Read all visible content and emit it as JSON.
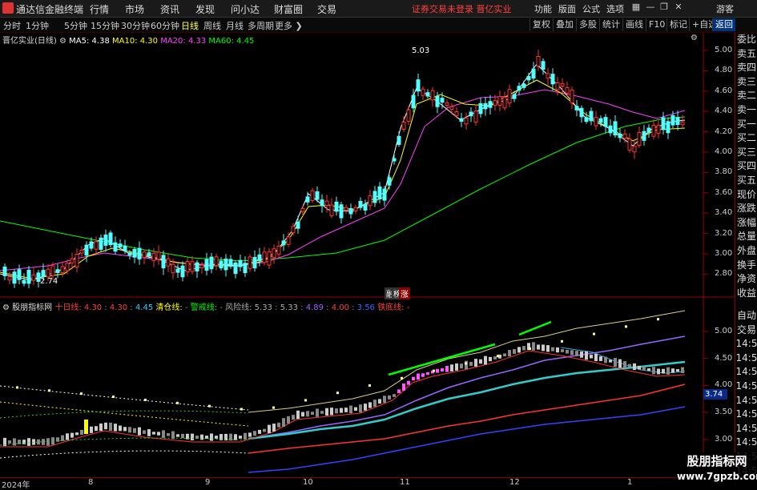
{
  "topbar": {
    "app_title": "通达信金融终端",
    "menus": [
      "行情",
      "市场",
      "资讯",
      "发现",
      "问小达",
      "财富圈",
      "交易"
    ],
    "notice": "证券交易未登录",
    "stock_name": "晋亿实业",
    "right_menus": [
      "功能",
      "版面",
      "公式",
      "选项"
    ],
    "user": "游客"
  },
  "periodbar": {
    "periods": [
      "分时",
      "1分钟",
      "5分钟",
      "15分钟",
      "30分钟",
      "60分钟",
      "日线",
      "周线",
      "月线",
      "多周期",
      "更多"
    ],
    "active_period": "日线",
    "tools": [
      "复权",
      "叠加",
      "多股",
      "统计",
      "画线",
      "F10",
      "标记",
      "+自选",
      "返回"
    ]
  },
  "kline": {
    "title": "晋亿实业(日线)",
    "ma_labels": [
      {
        "name": "MA5: 4.38",
        "color": "#ffffff"
      },
      {
        "name": "MA10: 4.30",
        "color": "#ffff00"
      },
      {
        "name": "MA20: 4.33",
        "color": "#ff40ff"
      },
      {
        "name": "MA60: 4.45",
        "color": "#00ff00"
      }
    ],
    "y_ticks": [
      "5.00",
      "4.80",
      "4.60",
      "4.40",
      "4.20",
      "4.00",
      "3.80",
      "3.60",
      "3.40",
      "3.20",
      "3.00",
      "2.80"
    ],
    "high_label": "5.03",
    "low_label": "2.74",
    "badges": [
      "融",
      "榜",
      "涨"
    ]
  },
  "indicator": {
    "name": "股朋指标网",
    "items": [
      {
        "label": "十日线:",
        "value": "4.30",
        "color": "#ff4040"
      },
      {
        "label": "",
        "value": "4.30",
        "color": "#ff4040"
      },
      {
        "label": "",
        "value": "4.45",
        "color": "#33ccff"
      },
      {
        "label": "清仓线:",
        "value": "",
        "color": "#ffff00"
      },
      {
        "label": "警戒线:",
        "value": "",
        "color": "#00ff00"
      },
      {
        "label": "风险线:",
        "value": "5.33",
        "color": "#aaaaaa"
      },
      {
        "label": "",
        "value": "5.33",
        "color": "#aaaaaa"
      },
      {
        "label": "",
        "value": "4.89",
        "color": "#9966ff"
      },
      {
        "label": "",
        "value": "4.00",
        "color": "#ff4040"
      },
      {
        "label": "",
        "value": "3.56",
        "color": "#3366ff"
      },
      {
        "label": "铁底线:",
        "value": "-",
        "color": "#ff4040"
      }
    ],
    "y_ticks": [
      "5.00",
      "4.50",
      "4.00",
      "3.50",
      "3.00"
    ],
    "current_value": "3.74"
  },
  "right_panel_top": [
    "委比",
    "卖五",
    "卖四",
    "卖三",
    "卖二",
    "卖一",
    "买一",
    "买二",
    "买三",
    "买四",
    "买五",
    "现价",
    "涨跌",
    "涨幅",
    "总量",
    "外盘",
    "换手",
    "净资",
    "收益"
  ],
  "right_panel_bottom": [
    "自动",
    "交易",
    "14:5",
    "14:5",
    "14:5",
    "14:5",
    "14:5",
    "14:5",
    "14:5",
    "14:5",
    "14:5",
    "14:5"
  ],
  "dateaxis": {
    "labels": [
      "2024年",
      "8",
      "9",
      "10",
      "11",
      "12",
      "1"
    ]
  },
  "watermark": {
    "line1": "股朋指标网",
    "line2": "www.7gpzb.com"
  },
  "colors": {
    "up": "#ff3333",
    "down": "#54ffff",
    "ma5": "#ffffff",
    "ma10": "#ffff00",
    "ma20": "#ff40ff",
    "ma60": "#00ff00"
  }
}
